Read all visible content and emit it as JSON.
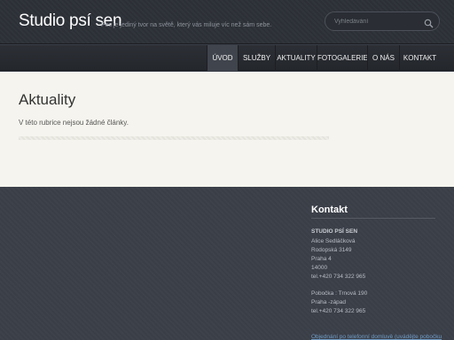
{
  "header": {
    "site_title": "Studio psí sen",
    "slogan": "Pes je jediný tvor na světě, který vás miluje víc než sám sebe.",
    "search_placeholder": "Vyhledávání",
    "search_icon": "search-icon"
  },
  "nav": {
    "items": [
      {
        "label": "ÚVOD",
        "active": true
      },
      {
        "label": "SLUŽBY",
        "active": false
      },
      {
        "label": "AKTUALITY",
        "active": false
      },
      {
        "label": "FOTOGALERIE",
        "active": false
      },
      {
        "label": "O NÁS",
        "active": false
      },
      {
        "label": "KONTAKT",
        "active": false
      }
    ]
  },
  "main": {
    "title": "Aktuality",
    "empty_message": "V této rubrice nejsou žádné články."
  },
  "footer": {
    "contact_title": "Kontakt",
    "lines": [
      "STUDIO PSÍ SEN",
      "Alice Sedláčková",
      "Rodopská 3149",
      "Praha 4",
      "14000",
      "tel.+420 734 322 965",
      "Pobočka : Trnová 190",
      "Praha -západ",
      "tel.+420 734 322 965"
    ],
    "link_text": "Objednání po telefonní domluvě (uvádějte pobočku"
  },
  "colors": {
    "header_bg": "#2c2f36",
    "content_bg": "#f5f4ee",
    "footer_bg": "#3a3e47",
    "active_nav_bg": "#40444c"
  }
}
